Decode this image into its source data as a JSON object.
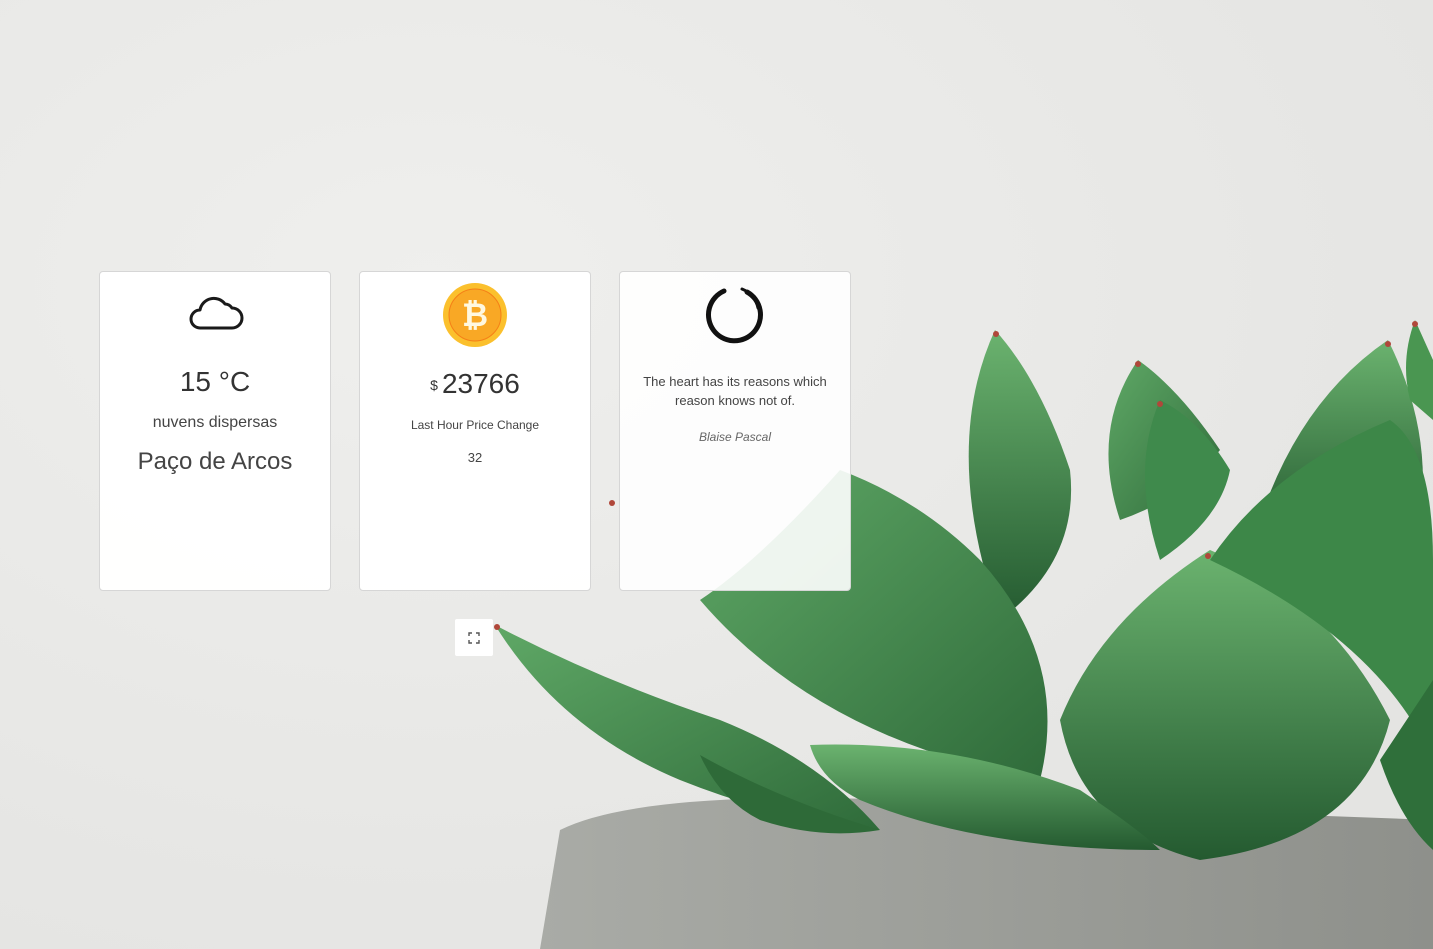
{
  "weather": {
    "icon": "cloud-icon",
    "temperature": "15 °C",
    "description": "nuvens dispersas",
    "city": "Paço de Arcos"
  },
  "crypto": {
    "icon": "bitcoin-icon",
    "currency_symbol": "$",
    "price": "23766",
    "change_label": "Last Hour Price Change",
    "change_value": "32"
  },
  "quote": {
    "icon": "enso-circle-icon",
    "text": "The heart has its reasons which reason knows not of.",
    "author": "Blaise Pascal"
  },
  "controls": {
    "fullscreen_icon": "expand-icon"
  },
  "colors": {
    "plant_green": "#3f8a4c",
    "bitcoin_orange": "#f7a600",
    "card_border": "#d6d6d6"
  }
}
